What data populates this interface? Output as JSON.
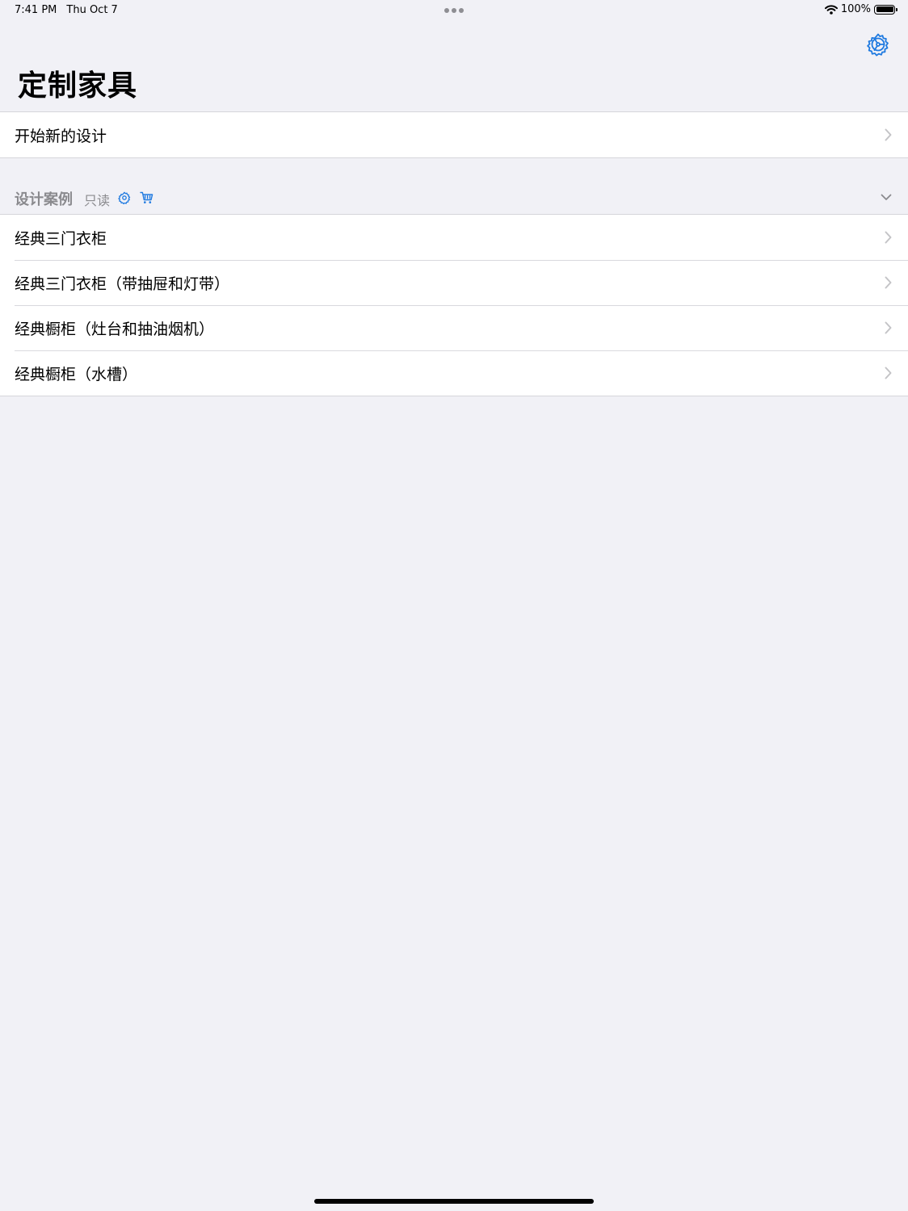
{
  "status_bar": {
    "time": "7:41 PM",
    "date": "Thu Oct 7",
    "battery": "100%"
  },
  "header": {
    "title": "定制家具",
    "settings_icon": "gear-icon"
  },
  "new_design": {
    "label": "开始新的设计"
  },
  "examples_section": {
    "title": "设计案例",
    "badge": "只读",
    "icons": [
      "gear-icon",
      "cart-icon",
      "chevron-down-icon"
    ],
    "items": [
      {
        "label": "经典三门衣柜"
      },
      {
        "label": "经典三门衣柜（带抽屉和灯带）"
      },
      {
        "label": "经典橱柜（灶台和抽油烟机）"
      },
      {
        "label": "经典橱柜（水槽）"
      }
    ]
  },
  "colors": {
    "accent": "#1f7ae0",
    "background": "#f1f1f6",
    "secondary_text": "#8a8a8e",
    "chevron": "#c4c4c7"
  }
}
